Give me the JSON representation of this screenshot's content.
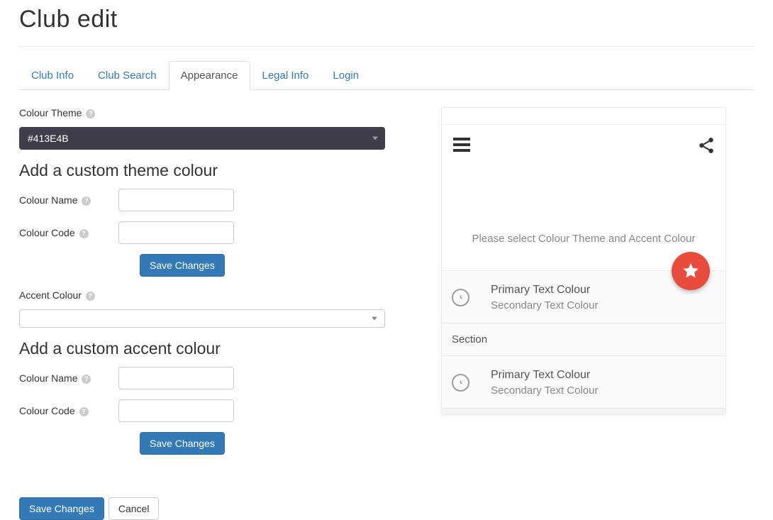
{
  "page": {
    "title": "Club edit"
  },
  "tabs": [
    {
      "label": "Club Info"
    },
    {
      "label": "Club Search"
    },
    {
      "label": "Appearance"
    },
    {
      "label": "Legal Info"
    },
    {
      "label": "Login"
    }
  ],
  "active_tab": 2,
  "form": {
    "colour_theme_label": "Colour Theme",
    "colour_theme_value": "#413E4B",
    "theme_heading": "Add a custom theme colour",
    "colour_name_label": "Colour Name",
    "colour_code_label": "Colour Code",
    "theme_name_value": "",
    "theme_code_value": "",
    "save_changes_label": "Save Changes",
    "accent_label": "Accent Colour",
    "accent_value": "",
    "accent_heading": "Add a custom accent colour",
    "accent_name_value": "",
    "accent_code_value": ""
  },
  "footer": {
    "save_label": "Save Changes",
    "cancel_label": "Cancel"
  },
  "preview": {
    "message": "Please select Colour Theme and Accent Colour",
    "accent_color": "#e84c3d",
    "items": [
      {
        "primary": "Primary Text Colour",
        "secondary": "Secondary Text Colour"
      },
      {
        "primary": "Primary Text Colour",
        "secondary": "Secondary Text Colour"
      }
    ],
    "section_label": "Section"
  }
}
